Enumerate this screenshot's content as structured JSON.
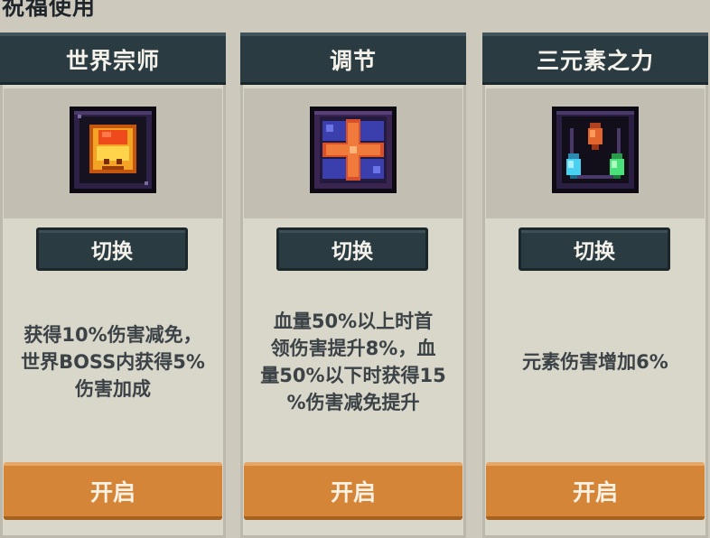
{
  "page": {
    "title": "祝福使用"
  },
  "cards": [
    {
      "title": "世界宗师",
      "icon": "bell-crown-icon",
      "switch_label": "切换",
      "description": [
        "获得10%伤害减免，",
        "世界BOSS内获得5%",
        "伤害加成"
      ],
      "open_label": "开启"
    },
    {
      "title": "调节",
      "icon": "cross-sparkle-icon",
      "switch_label": "切换",
      "description": [
        "血量50%以上时首",
        "领伤害提升8%，血",
        "量50%以下时获得15",
        "%伤害减免提升"
      ],
      "open_label": "开启"
    },
    {
      "title": "三元素之力",
      "icon": "three-crystals-icon",
      "switch_label": "切换",
      "description": [
        "元素伤害增加6%"
      ],
      "open_label": "开启"
    }
  ],
  "colors": {
    "background": "#cdc9bd",
    "header": "#2b3b42",
    "open_button": "#d48538",
    "text_dark": "#3c4347"
  }
}
